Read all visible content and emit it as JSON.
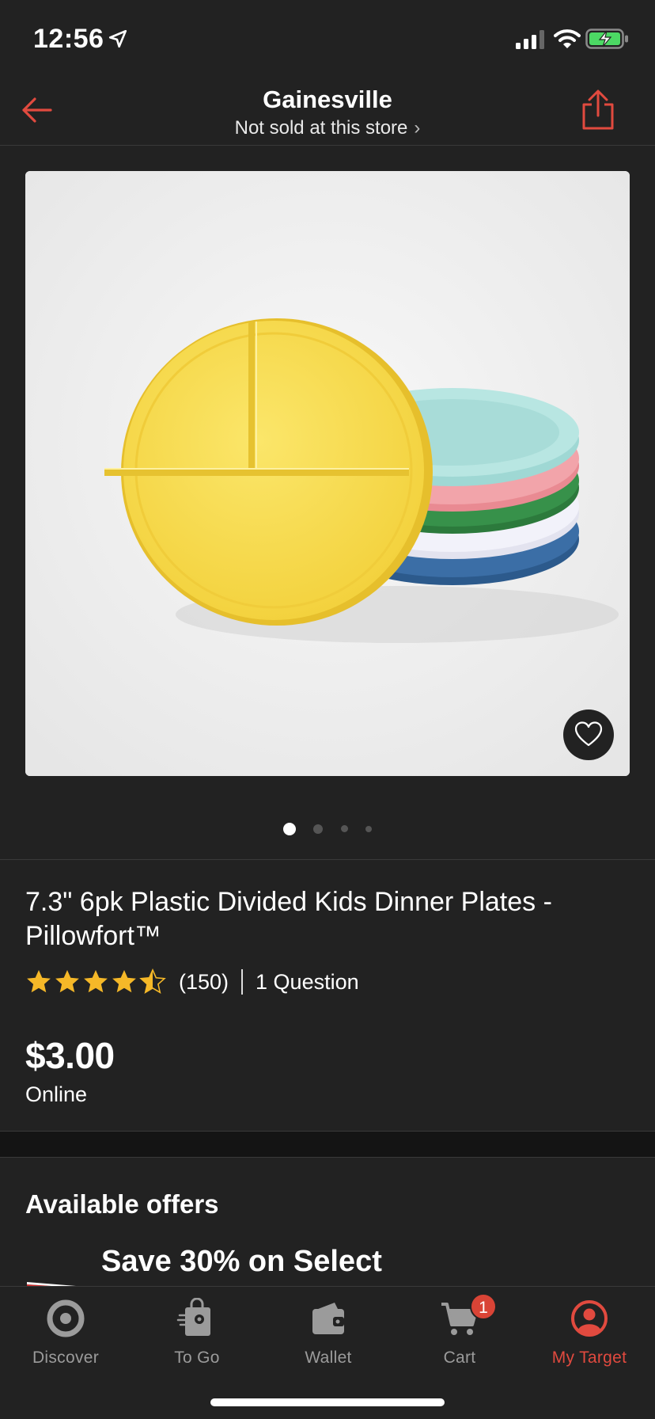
{
  "status_bar": {
    "time": "12:56"
  },
  "header": {
    "store_name": "Gainesville",
    "store_subtitle": "Not sold at this store",
    "chevron": "›"
  },
  "product": {
    "title": "7.3\" 6pk Plastic Divided Kids Dinner Plates - Pillowfort™",
    "rating": 4.5,
    "review_count": "(150)",
    "questions": "1 Question",
    "price": "$3.00",
    "availability": "Online",
    "image_count": 4,
    "image_index": 1
  },
  "offers": {
    "title": "Available offers",
    "first_offer": "Save 30% on Select"
  },
  "tabs": [
    {
      "label": "Discover",
      "icon": "target-icon"
    },
    {
      "label": "To Go",
      "icon": "shopping-bag-icon"
    },
    {
      "label": "Wallet",
      "icon": "wallet-icon"
    },
    {
      "label": "Cart",
      "icon": "cart-icon",
      "badge": "1"
    },
    {
      "label": "My Target",
      "icon": "account-icon",
      "active": true
    }
  ],
  "colors": {
    "background": "#222222",
    "accent": "#e14a3f",
    "tab_inactive": "#9b9b9b",
    "star": "#f5b828"
  }
}
